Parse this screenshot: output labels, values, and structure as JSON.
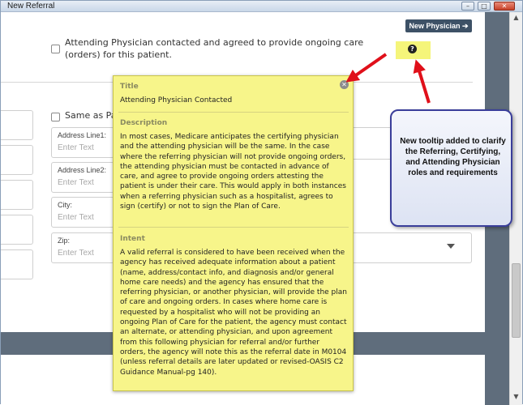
{
  "window": {
    "title": "New Referral",
    "controls": {
      "minimize": "–",
      "maximize": "□",
      "close": "✕"
    }
  },
  "new_physician_button": {
    "label": "New Physician ➔"
  },
  "attending": {
    "checkbox_text": "Attending Physician contacted and agreed to provide ongoing care (orders) for this patient.",
    "help_icon": "question-circle-icon"
  },
  "same_as_label": "Same as Pat",
  "address_fields": [
    {
      "label": "Address Line1:",
      "placeholder": "Enter Text"
    },
    {
      "label": "Address Line2:",
      "placeholder": "Enter Text"
    },
    {
      "label": "City:",
      "placeholder": "Enter Text"
    },
    {
      "label": "Zip:",
      "placeholder": "Enter Text"
    }
  ],
  "tooltip": {
    "title_heading": "Title",
    "title_text": "Attending Physician Contacted",
    "description_heading": "Description",
    "description_text": "In most cases, Medicare anticipates the certifying physician and the attending physician will be the same. In the case where the referring physician will not provide ongoing orders, the attending physician must be contacted in advance of care, and agree to provide ongoing orders attesting the patient is under their care. This would apply in both instances when a referring physician such as a hospitalist, agrees to sign (certify) or not to sign the Plan of Care.",
    "intent_heading": "Intent",
    "intent_text": "A valid referral is considered to have been received when the agency has received adequate information about a patient (name, address/contact info, and diagnosis and/or general home care needs) and the agency has ensured that the referring physician, or another physician, will provide the plan of care and ongoing orders. In cases where home care is requested by a hospitalist who will not be providing an ongoing Plan of Care for the patient, the agency must contact an alternate, or attending physician, and upon agreement from this following physician for referral and/or further orders, the agency will note this as the referral date in M0104 (unless referral details are later updated or revised-OASIS C2 Guidance Manual-pg 140).",
    "close_icon": "close-icon"
  },
  "callout": {
    "text": "New tooltip added to clarify the Referring, Certifying, and Attending Physician roles and requirements"
  },
  "colors": {
    "tooltip_bg": "#f7f58a",
    "arrow_red": "#e0101a",
    "callout_border": "#3a3e9a",
    "button_bg": "#3d5166"
  }
}
